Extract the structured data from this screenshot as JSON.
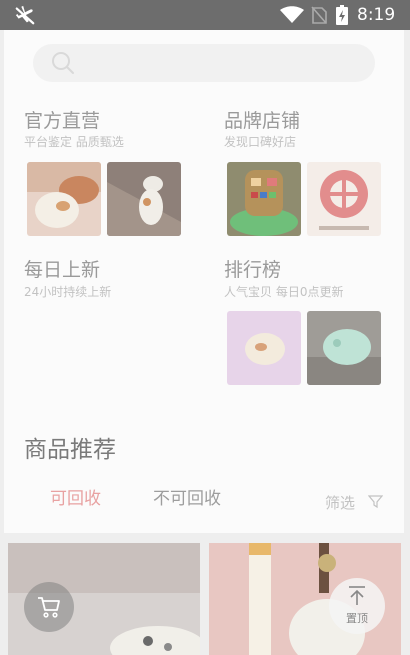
{
  "status_bar": {
    "time": "8:19"
  },
  "search": {
    "placeholder": ""
  },
  "sections": {
    "official": {
      "title": "官方直营",
      "subtitle": "平台鉴定 品质甄选"
    },
    "brand": {
      "title": "品牌店铺",
      "subtitle": "发现口碑好店"
    },
    "daily": {
      "title": "每日上新",
      "subtitle": "24小时持续上新"
    },
    "ranking": {
      "title": "排行榜",
      "subtitle": "人气宝贝 每日0点更新"
    }
  },
  "recommend": {
    "title": "商品推荐",
    "tabs": [
      {
        "label": "可回收",
        "active": true
      },
      {
        "label": "不可回收",
        "active": false
      }
    ],
    "filter_label": "筛选"
  },
  "floating": {
    "top_label": "置顶"
  },
  "colors": {
    "active_tab": "#e8a2a2",
    "status_bar": "#6d6d6d"
  }
}
